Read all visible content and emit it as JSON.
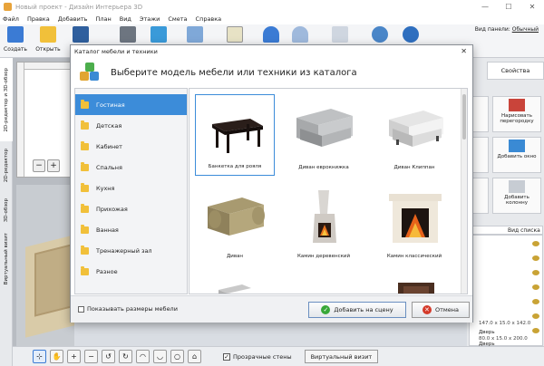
{
  "window": {
    "title": "Новый проект - Дизайн Интерьера 3D",
    "minimize": "—",
    "maximize": "☐",
    "close": "✕"
  },
  "menu": [
    "Файл",
    "Правка",
    "Добавить",
    "План",
    "Вид",
    "Этажи",
    "Смета",
    "Справка"
  ],
  "toolbar": {
    "create": "Создать",
    "open": "Открыть",
    "save": "Со",
    "view_panel_label": "Вид панели:",
    "view_panel_value": "Обычный"
  },
  "side_tabs": [
    "2D-редактор и 3D-обзор",
    "2D-редактор",
    "3D-обзор",
    "Виртуальный визит"
  ],
  "dialog": {
    "window_title": "Каталог мебели и техники",
    "header": "Выберите модель мебели или техники из каталога",
    "categories": [
      "Гостиная",
      "Детская",
      "Кабинет",
      "Спальня",
      "Кухня",
      "Прихожая",
      "Ванная",
      "Тренажерный зал",
      "Разное"
    ],
    "items": [
      {
        "caption": "Банкетка для рояля"
      },
      {
        "caption": "Диван еврокнижка"
      },
      {
        "caption": "Диван Клиппан"
      },
      {
        "caption": "Диван"
      },
      {
        "caption": "Камин деревенский"
      },
      {
        "caption": "Камин классический"
      }
    ],
    "show_sizes": "Показывать размеры мебели",
    "add_button": "Добавить на сцену",
    "cancel_button": "Отмена"
  },
  "right_panel": {
    "properties_tab": "Свойства",
    "draw_partition": "Нарисовать перегородку",
    "add_window": "Добавить окно",
    "add_column": "Добавить колонну",
    "list_view_label": "Вид списка",
    "list_item_size": "147.0 x 15.0 x 142.0",
    "door_label": "Дверь",
    "door_size": "80.0 x 15.0 x 200.0",
    "door_label_2": "Дверь"
  },
  "bottom": {
    "transparent_walls": "Прозрачные стены",
    "virtual_visit": "Виртуальный визит"
  },
  "colors": {
    "selection_blue": "#3c8cd9",
    "folder_yellow": "#f1c03a",
    "ok_green": "#38a838",
    "cancel_red": "#d43a2a"
  }
}
